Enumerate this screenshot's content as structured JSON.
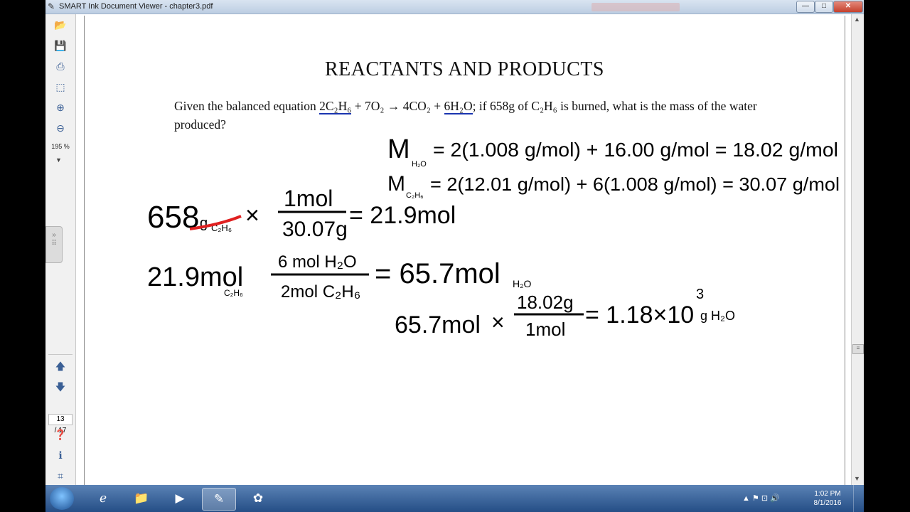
{
  "window": {
    "title": "SMART Ink Document Viewer - chapter3.pdf",
    "minimize": "—",
    "maximize": "□",
    "close": "✕"
  },
  "toolbar": {
    "zoom": "195 %",
    "page_current": "13",
    "page_total": "/ 17"
  },
  "doc": {
    "title": "REACTANTS AND PRODUCTS",
    "question_a": "Given the balanced equation ",
    "question_eq1": "2C₂H₆",
    "question_b": " + 7O₂ → 4CO₂ + ",
    "question_eq2": "6H₂O",
    "question_c": "; if 658g of C₂H₆ is burned, what is the mass of the water produced?"
  },
  "ink": {
    "line1_m": "M",
    "line1_sub": "H₂O",
    "line1_body": "= 2(1.008 g/mol) + 16.00 g/mol = 18.02 g/mol",
    "line2_m": "M",
    "line2_sub": "C₂H₆",
    "line2_body": "= 2(12.01 g/mol) + 6(1.008 g/mol) = 30.07 g/mol",
    "step1_qty": "658",
    "step1_unit": "g",
    "step1_sub": "C₂H₆",
    "times": "×",
    "step1_num": "1mol",
    "step1_den": "30.07g",
    "step1_res": "= 21.9mol",
    "step2_qty": "21.9mol",
    "step2_sub": "C₂H₆",
    "step2_num": "6 mol H₂O",
    "step2_den": "2mol C₂H₆",
    "step2_res": "= 65.7mol",
    "step2_res_sub": "H₂O",
    "step3_qty": "65.7mol",
    "step3_num": "18.02g",
    "step3_den": "1mol",
    "step3_res": "= 1.18×10",
    "step3_exp": "3",
    "step3_unit": "g H₂O"
  },
  "taskbar": {
    "clock_time": "1:02 PM",
    "clock_date": "8/1/2016",
    "tray_icons": "▲  ⚑  ⊡  🔊"
  },
  "colors": {
    "ink": "#000000",
    "underline": "#1a35b0",
    "strike": "#e02020"
  }
}
